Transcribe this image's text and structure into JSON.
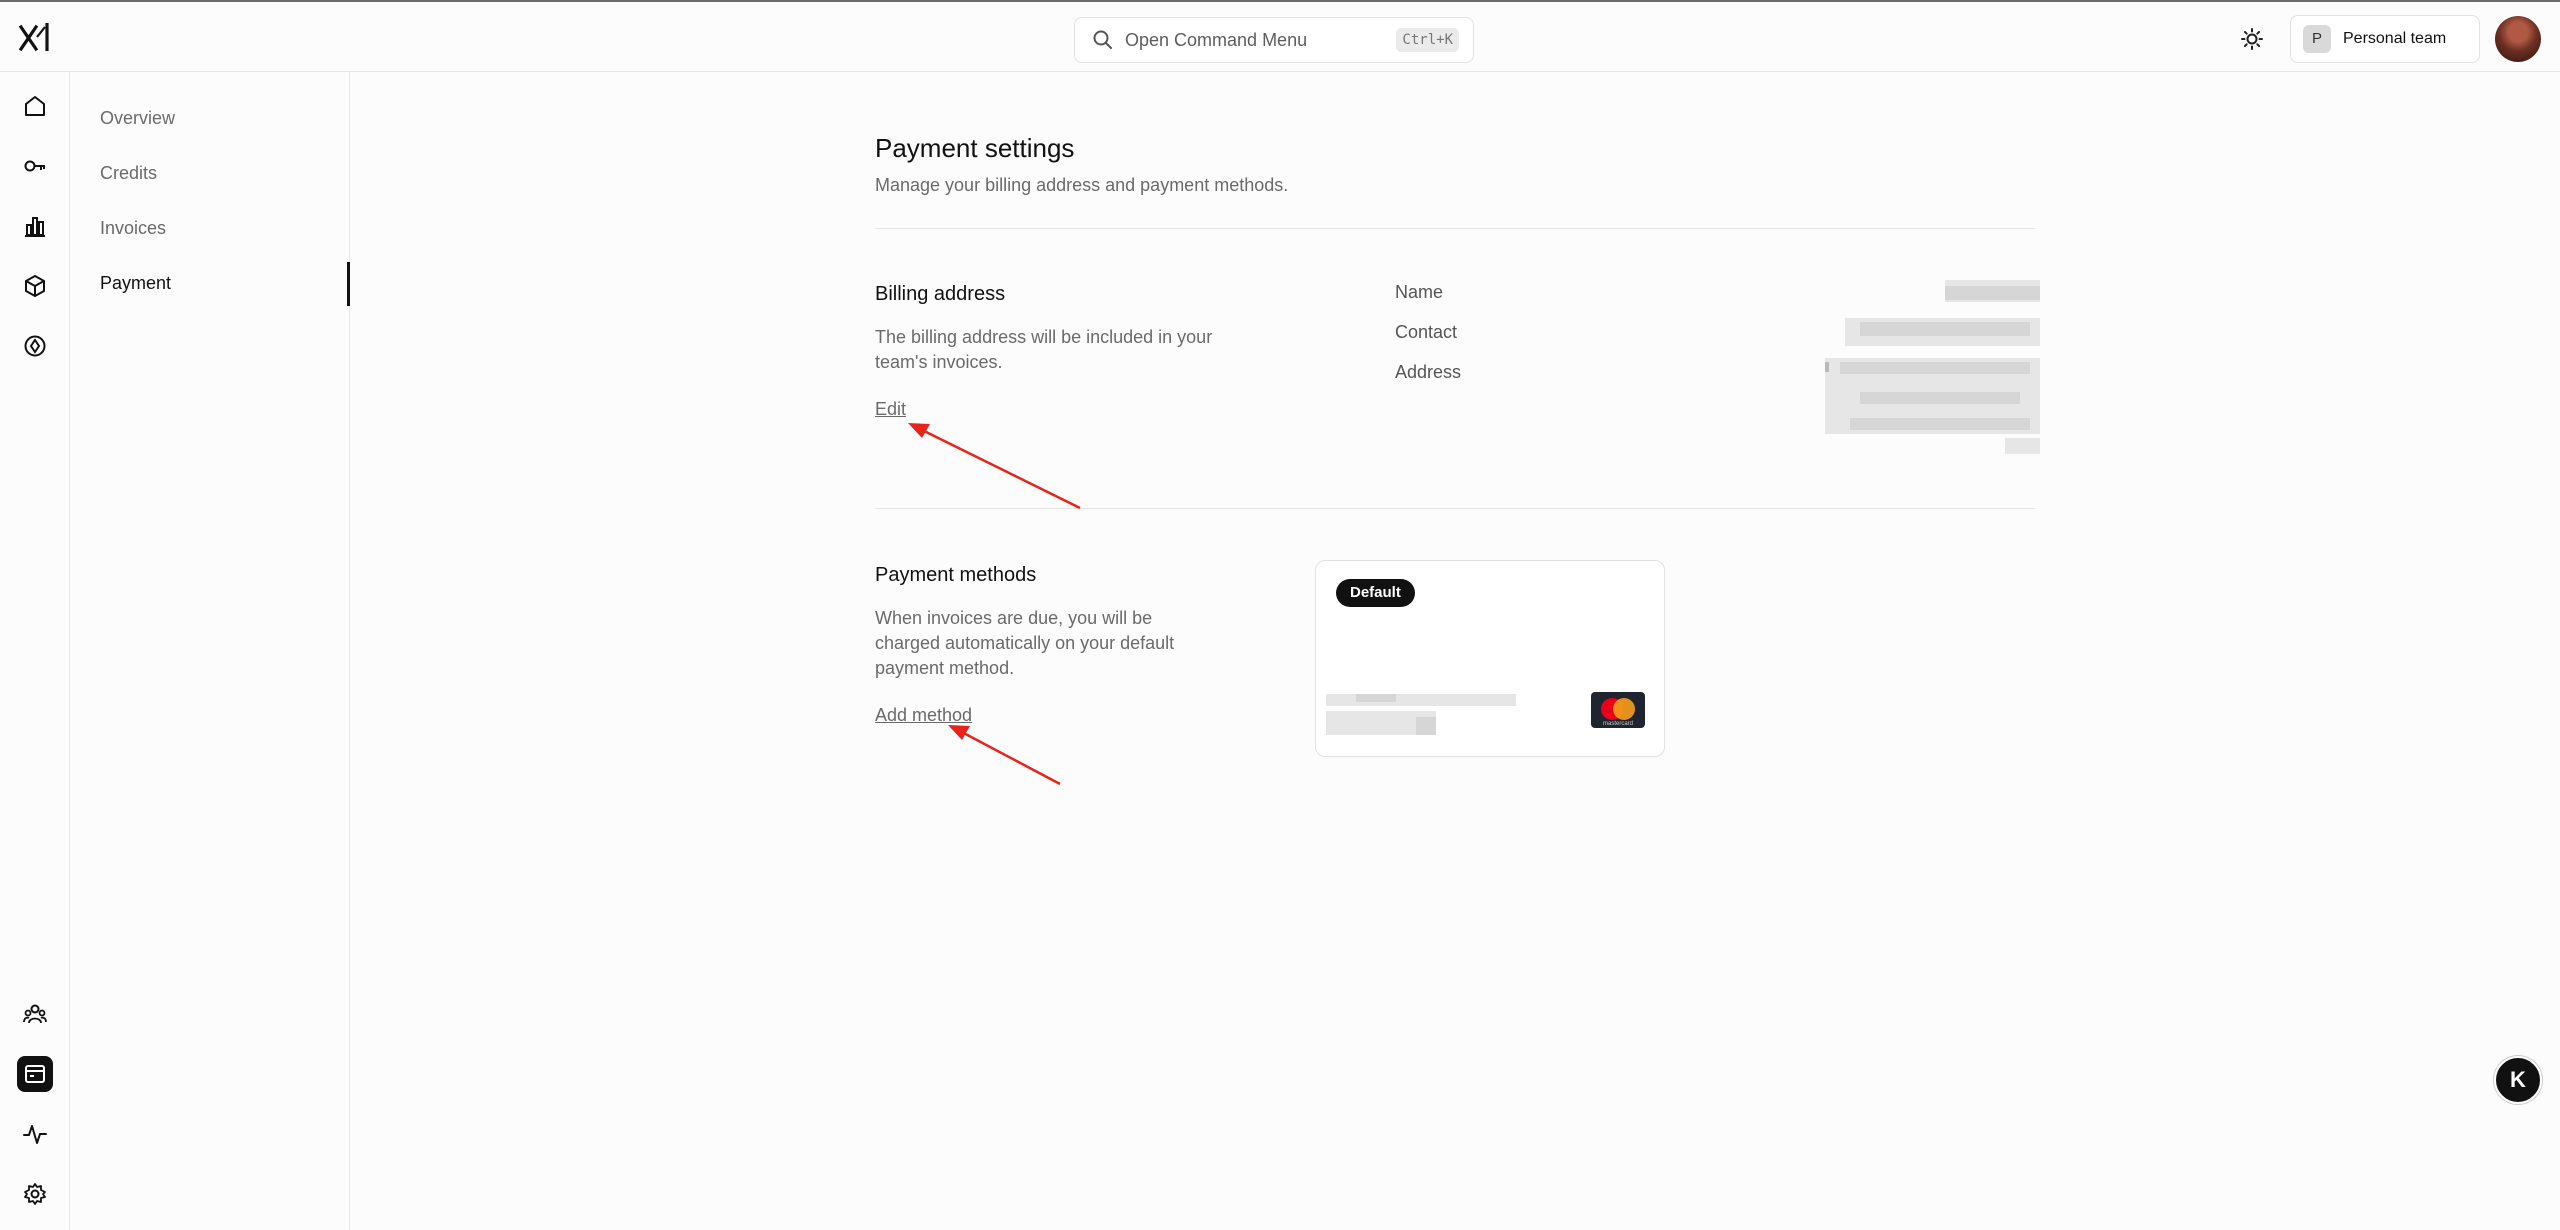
{
  "header": {
    "command_menu_label": "Open Command Menu",
    "command_menu_shortcut": "Ctrl+K",
    "team_initial": "P",
    "team_name": "Personal team"
  },
  "sidebar": {
    "items": [
      {
        "label": "Overview",
        "active": false
      },
      {
        "label": "Credits",
        "active": false
      },
      {
        "label": "Invoices",
        "active": false
      },
      {
        "label": "Payment",
        "active": true
      }
    ]
  },
  "rail": {
    "icons": [
      "home-icon",
      "key-icon",
      "bar-chart-icon",
      "cube-icon",
      "compass-icon",
      "team-icon",
      "billing-icon",
      "activity-icon",
      "settings-icon"
    ],
    "active": "billing-icon"
  },
  "page": {
    "title": "Payment settings",
    "subtitle": "Manage your billing address and payment methods."
  },
  "billing": {
    "title": "Billing address",
    "description": "The billing address will be included in your team's invoices.",
    "edit_label": "Edit",
    "fields": {
      "name_label": "Name",
      "contact_label": "Contact",
      "address_label": "Address"
    }
  },
  "payment_methods": {
    "title": "Payment methods",
    "description": "When invoices are due, you will be charged automatically on your default payment method.",
    "add_label": "Add method",
    "card": {
      "badge": "Default",
      "brand": "mastercard"
    }
  },
  "colors": {
    "accent": "#111111",
    "arrow": "#e8231a",
    "muted_text": "#6a6a6a"
  }
}
